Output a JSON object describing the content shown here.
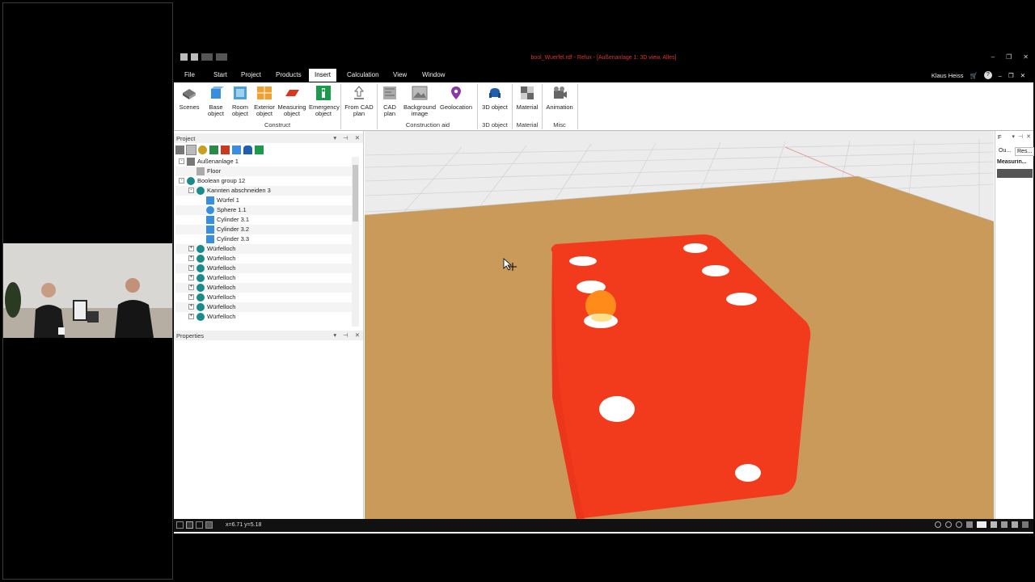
{
  "window": {
    "title": "bool_Wuerfel.rdf - Relux - [Außenanlage 1: 3D view, Alles]",
    "user": "Klaus Heiss"
  },
  "menu": {
    "tabs": [
      "File",
      "Start",
      "Project",
      "Products",
      "Insert",
      "Calculation",
      "View",
      "Window"
    ],
    "active": "Insert"
  },
  "ribbon": {
    "buttons": {
      "scenes": "Scenes",
      "base": "Base object",
      "room": "Room object",
      "exterior": "Exterior object",
      "measuring": "Measuring object",
      "emergency": "Emergency object",
      "from_cad": "From CAD plan",
      "cad": "CAD plan",
      "background": "Background image",
      "geolocation": "Geolocation",
      "object3d": "3D object",
      "material": "Material",
      "animation": "Animation"
    },
    "groups": {
      "construct": "Construct",
      "construction_aid": "Construction aid",
      "object3d": "3D object",
      "material": "Material",
      "misc": "Misc"
    }
  },
  "project_panel": {
    "title": "Project",
    "tree": [
      {
        "label": "Außenanlage 1",
        "level": 0,
        "expander": "-",
        "icon": "outdoor-icon"
      },
      {
        "label": "Floor",
        "level": 1,
        "expander": "",
        "icon": "floor-icon"
      },
      {
        "label": "Boolean group 12",
        "level": 0,
        "expander": "-",
        "icon": "boolean-icon"
      },
      {
        "label": "Kannten abschneiden 3",
        "level": 1,
        "expander": "-",
        "icon": "boolean-icon"
      },
      {
        "label": "Würfel 1",
        "level": 2,
        "expander": "",
        "icon": "cube-icon"
      },
      {
        "label": "Sphere 1.1",
        "level": 2,
        "expander": "",
        "icon": "sphere-icon"
      },
      {
        "label": "Cylinder 3.1",
        "level": 2,
        "expander": "",
        "icon": "cylinder-icon"
      },
      {
        "label": "Cylinder 3.2",
        "level": 2,
        "expander": "",
        "icon": "cylinder-icon"
      },
      {
        "label": "Cylinder 3.3",
        "level": 2,
        "expander": "",
        "icon": "cylinder-icon"
      },
      {
        "label": "Würfelloch",
        "level": 1,
        "expander": "+",
        "icon": "boolean-icon"
      },
      {
        "label": "Würfelloch",
        "level": 1,
        "expander": "+",
        "icon": "boolean-icon"
      },
      {
        "label": "Würfelloch",
        "level": 1,
        "expander": "+",
        "icon": "boolean-icon"
      },
      {
        "label": "Würfelloch",
        "level": 1,
        "expander": "+",
        "icon": "boolean-icon"
      },
      {
        "label": "Würfelloch",
        "level": 1,
        "expander": "+",
        "icon": "boolean-icon"
      },
      {
        "label": "Würfelloch",
        "level": 1,
        "expander": "+",
        "icon": "boolean-icon"
      },
      {
        "label": "Würfelloch",
        "level": 1,
        "expander": "+",
        "icon": "boolean-icon"
      },
      {
        "label": "Würfelloch",
        "level": 1,
        "expander": "+",
        "icon": "boolean-icon"
      }
    ]
  },
  "properties_panel": {
    "title": "Properties"
  },
  "right_panel": {
    "title": "F",
    "tabs": [
      "Ou...",
      "Res..."
    ],
    "item": "Measurin..."
  },
  "statusbar": {
    "coords": "x=6.71 y=5.18"
  },
  "colors": {
    "die": "#f23a1c",
    "floor": "#c99a5a",
    "pip": "#ffffff",
    "highlight": "#ff8c1a"
  }
}
